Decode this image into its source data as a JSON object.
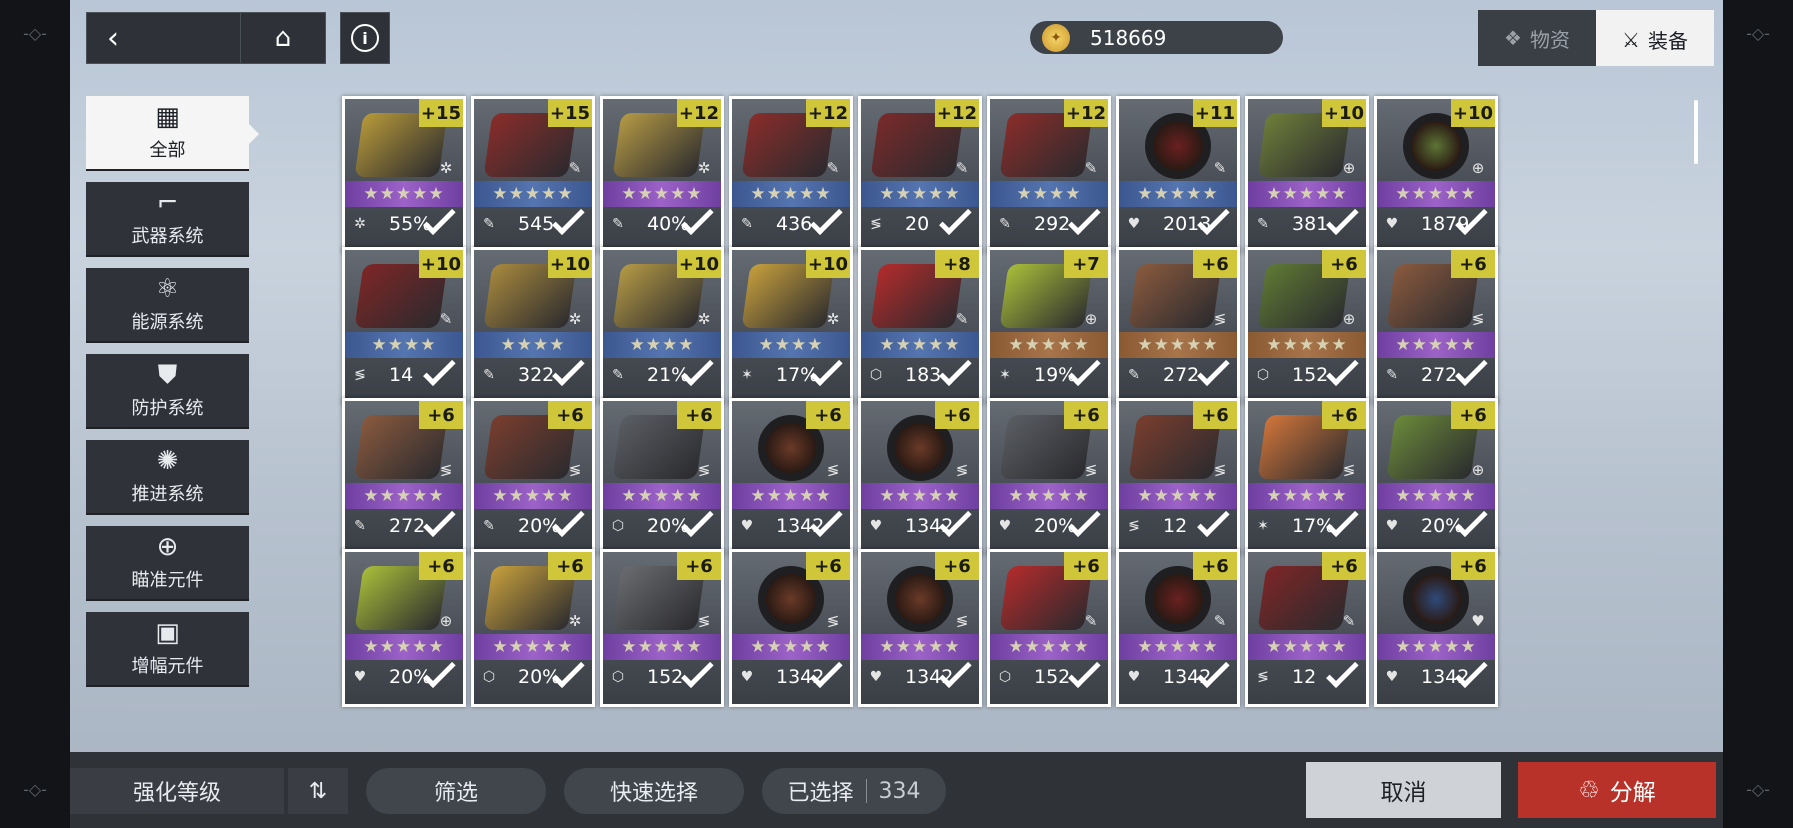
{
  "header": {
    "back_icon": "chevron-left-icon",
    "home_icon": "home-icon",
    "info_icon": "info-icon",
    "coins": "518669",
    "tabs": [
      {
        "label": "物资",
        "icon": "supplies-icon"
      },
      {
        "label": "装备",
        "icon": "equipment-icon"
      }
    ]
  },
  "categories": [
    {
      "label": "全部",
      "icon": "grid-icon"
    },
    {
      "label": "武器系统",
      "icon": "gun-icon"
    },
    {
      "label": "能源系统",
      "icon": "energy-icon"
    },
    {
      "label": "防护系统",
      "icon": "shield-icon"
    },
    {
      "label": "推进系统",
      "icon": "thruster-icon"
    },
    {
      "label": "瞄准元件",
      "icon": "crosshair-icon"
    },
    {
      "label": "增幅元件",
      "icon": "chip-icon"
    }
  ],
  "items": [
    {
      "level": "+15",
      "stat": "55%",
      "stars": "★★★★★",
      "band": "purple",
      "color": "#b89a3a",
      "round": false,
      "stat_icon": "✲",
      "sub_icon": "✲"
    },
    {
      "level": "+15",
      "stat": "545",
      "stars": "★★★★★",
      "band": "blue",
      "color": "#8a2d2a",
      "round": false,
      "stat_icon": "✎",
      "sub_icon": "✎"
    },
    {
      "level": "+12",
      "stat": "40%",
      "stars": "★★★★★",
      "band": "purple",
      "color": "#b59a45",
      "round": false,
      "stat_icon": "✎",
      "sub_icon": "✲"
    },
    {
      "level": "+12",
      "stat": "436",
      "stars": "★★★★★",
      "band": "blue",
      "color": "#8a2d2a",
      "round": false,
      "stat_icon": "✎",
      "sub_icon": "✎"
    },
    {
      "level": "+12",
      "stat": "20",
      "stars": "★★★★★",
      "band": "blue",
      "color": "#7a2a2a",
      "round": false,
      "stat_icon": "≶",
      "sub_icon": "✎"
    },
    {
      "level": "+12",
      "stat": "292",
      "stars": "★★★★",
      "band": "blue",
      "color": "#8a2d2a",
      "round": false,
      "stat_icon": "✎",
      "sub_icon": "✎"
    },
    {
      "level": "+11",
      "stat": "2013",
      "stars": "★★★★★",
      "band": "blue",
      "color": "#6a2020",
      "round": true,
      "stat_icon": "♥",
      "sub_icon": "✎"
    },
    {
      "level": "+10",
      "stat": "381",
      "stars": "★★★★★",
      "band": "purple",
      "color": "#6f7f3a",
      "round": false,
      "stat_icon": "✎",
      "sub_icon": "⊕"
    },
    {
      "level": "+10",
      "stat": "1879",
      "stars": "★★★★★",
      "band": "purple",
      "color": "#5d7434",
      "round": true,
      "stat_icon": "♥",
      "sub_icon": "⊕"
    },
    {
      "level": "+10",
      "stat": "14",
      "stars": "★★★★",
      "band": "blue",
      "color": "#7e2626",
      "round": false,
      "stat_icon": "≶",
      "sub_icon": "✎"
    },
    {
      "level": "+10",
      "stat": "322",
      "stars": "★★★★",
      "band": "blue",
      "color": "#a8893e",
      "round": false,
      "stat_icon": "✎",
      "sub_icon": "✲"
    },
    {
      "level": "+10",
      "stat": "21%",
      "stars": "★★★★",
      "band": "blue",
      "color": "#b59a45",
      "round": false,
      "stat_icon": "✎",
      "sub_icon": "✲"
    },
    {
      "level": "+10",
      "stat": "17%",
      "stars": "★★★★",
      "band": "blue",
      "color": "#c7a03d",
      "round": false,
      "stat_icon": "✶",
      "sub_icon": "✲"
    },
    {
      "level": "+8",
      "stat": "183",
      "stars": "★★★★★",
      "band": "blue",
      "color": "#b32b2b",
      "round": false,
      "stat_icon": "⬡",
      "sub_icon": "✎"
    },
    {
      "level": "+7",
      "stat": "19%",
      "stars": "★★★★★",
      "band": "orange",
      "color": "#a9bf3a",
      "round": false,
      "stat_icon": "✶",
      "sub_icon": "⊕"
    },
    {
      "level": "+6",
      "stat": "272",
      "stars": "★★★★★",
      "band": "orange",
      "color": "#8a5a3e",
      "round": false,
      "stat_icon": "✎",
      "sub_icon": "≶"
    },
    {
      "level": "+6",
      "stat": "152",
      "stars": "★★★★★",
      "band": "orange",
      "color": "#5f7a34",
      "round": false,
      "stat_icon": "⬡",
      "sub_icon": "⊕"
    },
    {
      "level": "+6",
      "stat": "272",
      "stars": "★★★★★",
      "band": "purple",
      "color": "#8a5a3e",
      "round": false,
      "stat_icon": "✎",
      "sub_icon": "≶"
    },
    {
      "level": "+6",
      "stat": "272",
      "stars": "★★★★★",
      "band": "purple",
      "color": "#8a5a3e",
      "round": false,
      "stat_icon": "✎",
      "sub_icon": "≶"
    },
    {
      "level": "+6",
      "stat": "20%",
      "stars": "★★★★★",
      "band": "purple",
      "color": "#7a3e2e",
      "round": false,
      "stat_icon": "✎",
      "sub_icon": "≶"
    },
    {
      "level": "+6",
      "stat": "20%",
      "stars": "★★★★★",
      "band": "purple",
      "color": "#5b5e63",
      "round": false,
      "stat_icon": "⬡",
      "sub_icon": "≶"
    },
    {
      "level": "+6",
      "stat": "1342",
      "stars": "★★★★★",
      "band": "purple",
      "color": "#6a3a28",
      "round": true,
      "stat_icon": "♥",
      "sub_icon": "≶"
    },
    {
      "level": "+6",
      "stat": "1342",
      "stars": "★★★★★",
      "band": "purple",
      "color": "#6a3a28",
      "round": true,
      "stat_icon": "♥",
      "sub_icon": "≶"
    },
    {
      "level": "+6",
      "stat": "20%",
      "stars": "★★★★★",
      "band": "purple",
      "color": "#5b5e63",
      "round": false,
      "stat_icon": "♥",
      "sub_icon": "≶"
    },
    {
      "level": "+6",
      "stat": "12",
      "stars": "★★★★★",
      "band": "purple",
      "color": "#7a3e2e",
      "round": false,
      "stat_icon": "≶",
      "sub_icon": "≶"
    },
    {
      "level": "+6",
      "stat": "17%",
      "stars": "★★★★★",
      "band": "purple",
      "color": "#d2763a",
      "round": false,
      "stat_icon": "✶",
      "sub_icon": "≶"
    },
    {
      "level": "+6",
      "stat": "20%",
      "stars": "★★★★★",
      "band": "purple",
      "color": "#6b8a3a",
      "round": false,
      "stat_icon": "♥",
      "sub_icon": "⊕"
    },
    {
      "level": "+6",
      "stat": "20%",
      "stars": "★★★★★",
      "band": "purple",
      "color": "#a9bf3a",
      "round": false,
      "stat_icon": "♥",
      "sub_icon": "⊕"
    },
    {
      "level": "+6",
      "stat": "20%",
      "stars": "★★★★★",
      "band": "purple",
      "color": "#c7a03d",
      "round": false,
      "stat_icon": "⬡",
      "sub_icon": "✲"
    },
    {
      "level": "+6",
      "stat": "152",
      "stars": "★★★★★",
      "band": "purple",
      "color": "#6a6c70",
      "round": false,
      "stat_icon": "⬡",
      "sub_icon": "≶"
    },
    {
      "level": "+6",
      "stat": "1342",
      "stars": "★★★★★",
      "band": "purple",
      "color": "#6a3a28",
      "round": true,
      "stat_icon": "♥",
      "sub_icon": "≶"
    },
    {
      "level": "+6",
      "stat": "1342",
      "stars": "★★★★★",
      "band": "purple",
      "color": "#6a3a28",
      "round": true,
      "stat_icon": "♥",
      "sub_icon": "≶"
    },
    {
      "level": "+6",
      "stat": "152",
      "stars": "★★★★★",
      "band": "purple",
      "color": "#b32b2b",
      "round": false,
      "stat_icon": "⬡",
      "sub_icon": "✎"
    },
    {
      "level": "+6",
      "stat": "1342",
      "stars": "★★★★★",
      "band": "purple",
      "color": "#6a2020",
      "round": true,
      "stat_icon": "♥",
      "sub_icon": "✎"
    },
    {
      "level": "+6",
      "stat": "12",
      "stars": "★★★★★",
      "band": "purple",
      "color": "#7e2626",
      "round": false,
      "stat_icon": "≶",
      "sub_icon": "✎"
    },
    {
      "level": "+6",
      "stat": "1342",
      "stars": "★★★★★",
      "band": "purple",
      "color": "#2f4a7a",
      "round": true,
      "stat_icon": "♥",
      "sub_icon": "♥"
    }
  ],
  "footer": {
    "sort_label": "强化等级",
    "sort_icon": "sort-order-icon",
    "filter_label": "筛选",
    "quick_select_label": "快速选择",
    "selected_label": "已选择",
    "selected_count": "334",
    "cancel_label": "取消",
    "decompose_label": "分解",
    "decompose_icon": "recycle-icon"
  }
}
